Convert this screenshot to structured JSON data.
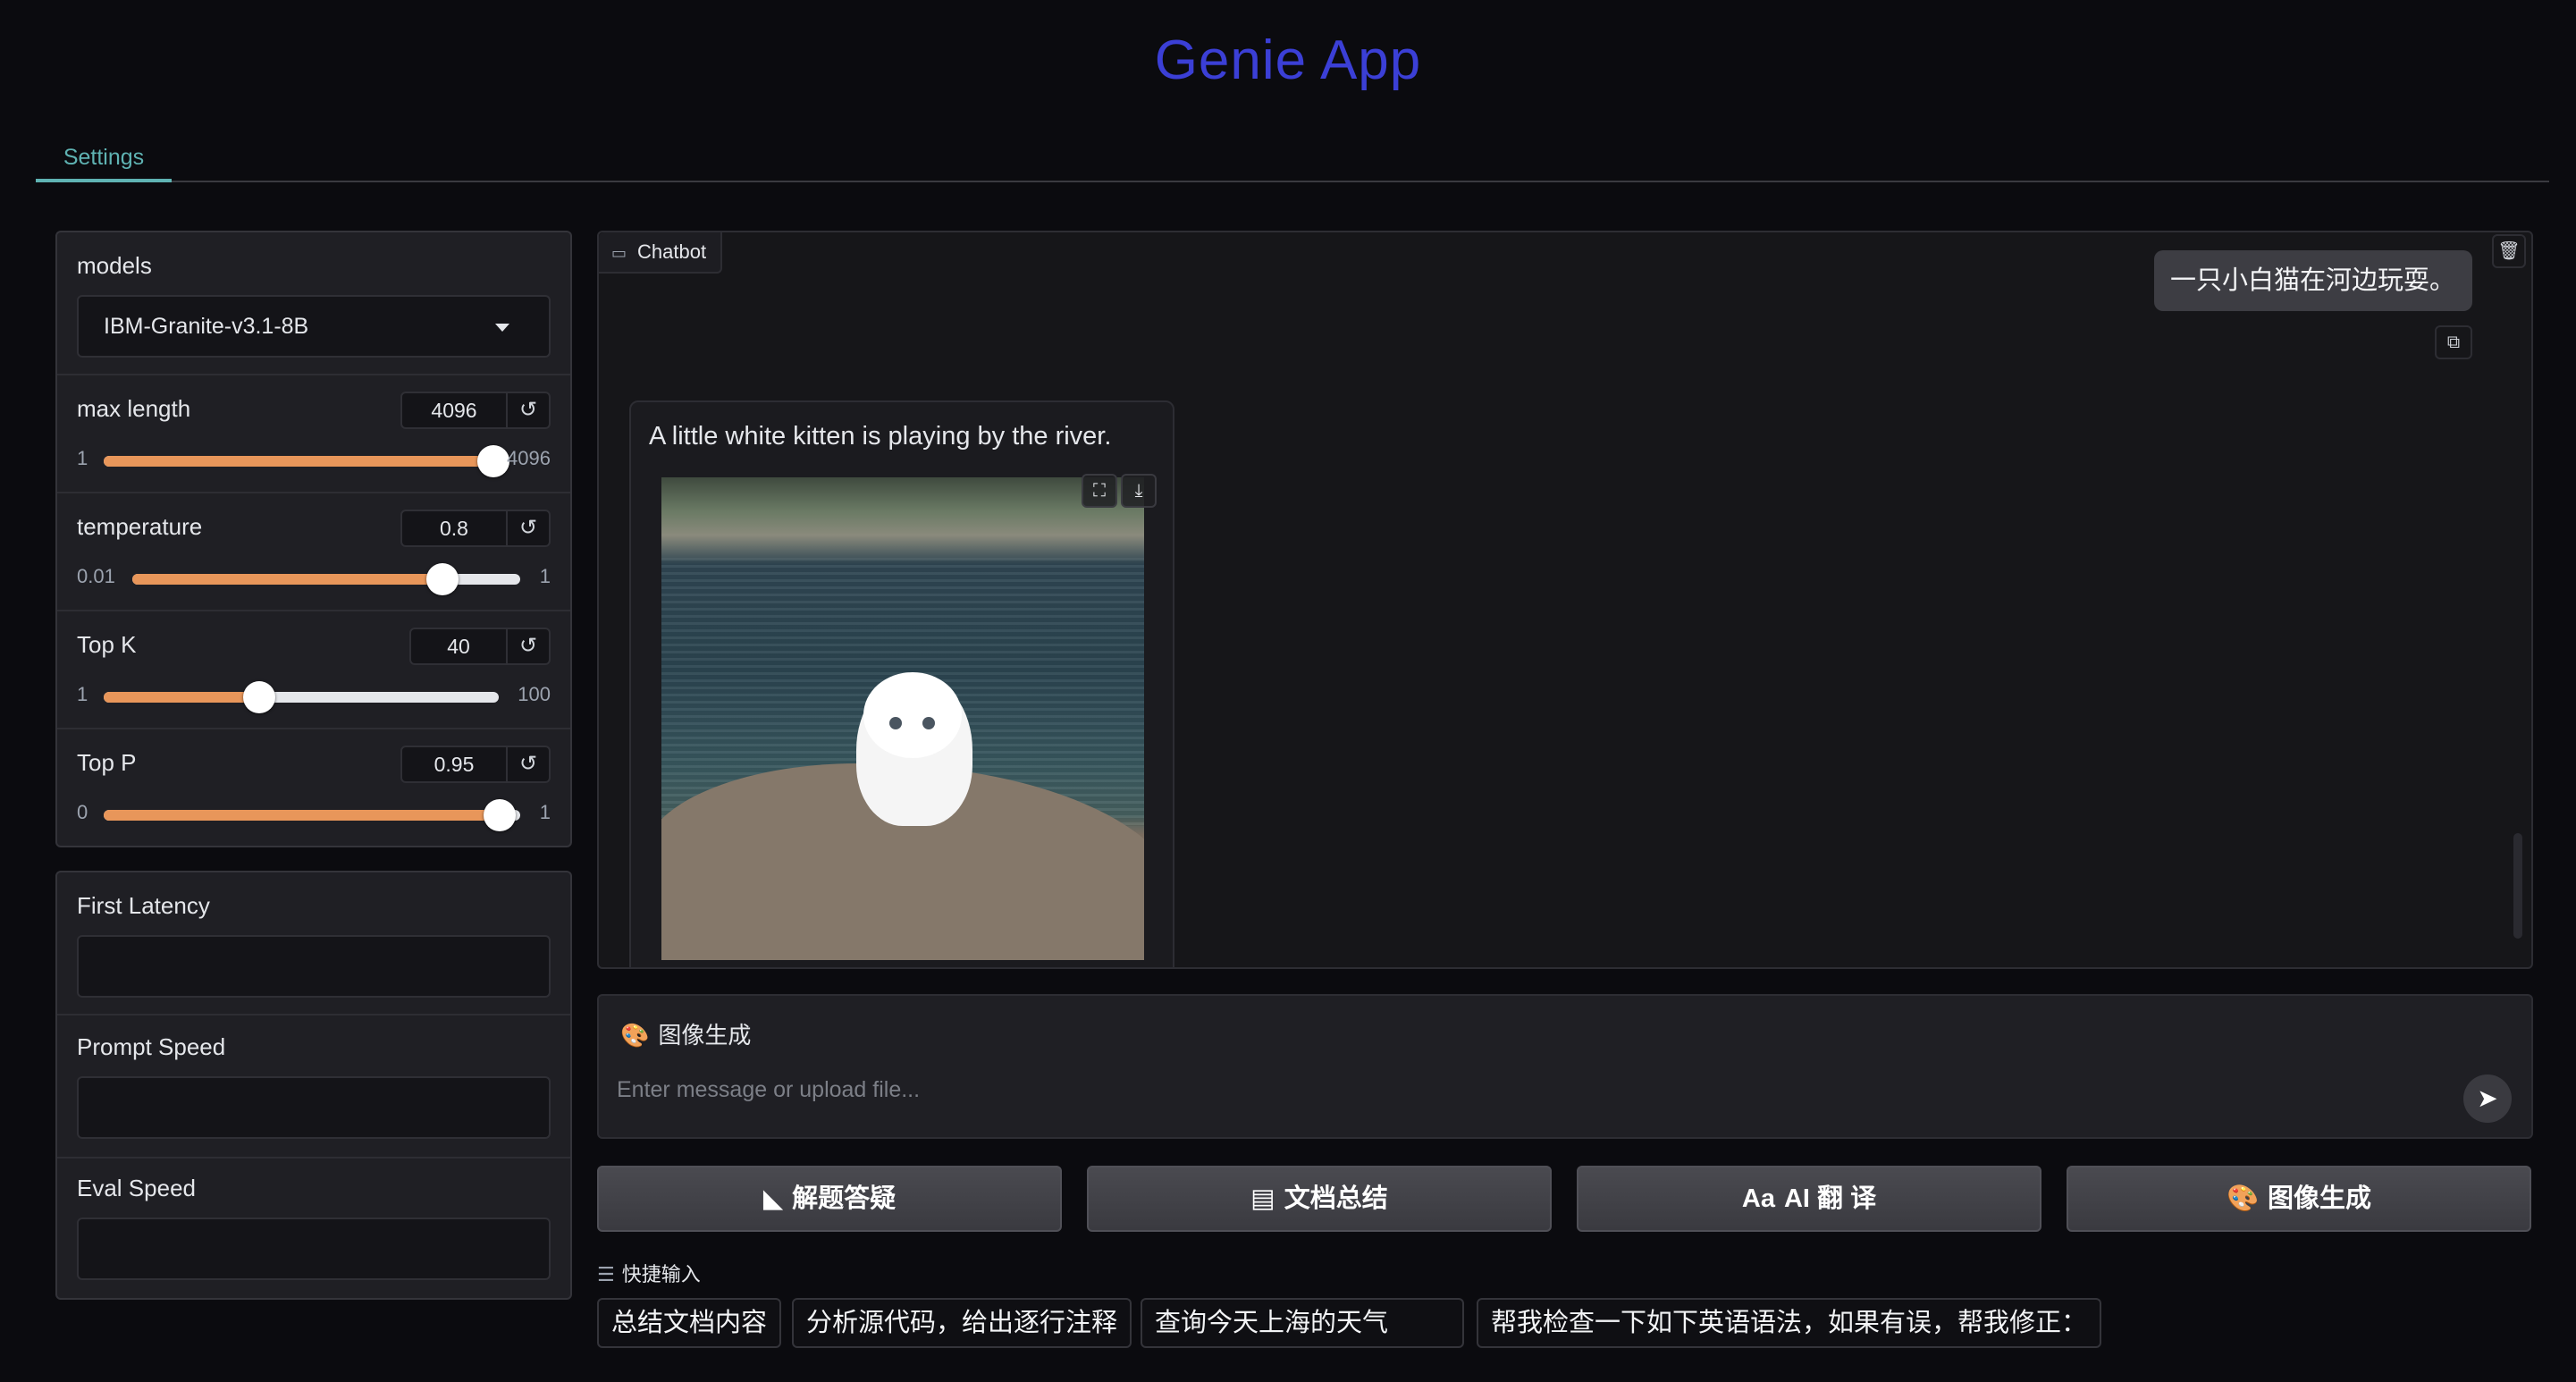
{
  "app": {
    "title": "Genie App"
  },
  "tabs": [
    {
      "label": "Settings"
    }
  ],
  "settings": {
    "models": {
      "label": "models",
      "selected": "IBM-Granite-v3.1-8B"
    },
    "max_length": {
      "label": "max length",
      "value": "4096",
      "min": "1",
      "max": "4096",
      "fill_fraction": 1.0
    },
    "temperature": {
      "label": "temperature",
      "value": "0.8",
      "min": "0.01",
      "max": "1",
      "fill_fraction": 0.8
    },
    "top_k": {
      "label": "Top K",
      "value": "40",
      "min": "1",
      "max": "100",
      "fill_fraction": 0.394
    },
    "top_p": {
      "label": "Top P",
      "value": "0.95",
      "min": "0",
      "max": "1",
      "fill_fraction": 0.95
    },
    "reset_icon": "↺"
  },
  "metrics": {
    "first_latency": {
      "label": "First Latency",
      "value": ""
    },
    "prompt_speed": {
      "label": "Prompt Speed",
      "value": ""
    },
    "eval_speed": {
      "label": "Eval Speed",
      "value": ""
    }
  },
  "chatbot": {
    "label": "Chatbot",
    "messages": [
      {
        "role": "user",
        "text": "一只小白猫在河边玩耍。"
      },
      {
        "role": "assistant",
        "text": "A little white kitten is playing by the river.",
        "image": "white-kitten-by-river"
      }
    ]
  },
  "input": {
    "mode_label": "图像生成",
    "placeholder": "Enter message or upload file..."
  },
  "actions": [
    {
      "label": "解题答疑",
      "icon": "ruler-triangle-icon",
      "glyph": "◣"
    },
    {
      "label": "文档总结",
      "icon": "documents-icon",
      "glyph": "▤"
    },
    {
      "label": "AI 翻 译",
      "icon": "font-size-icon",
      "glyph": "Aa"
    },
    {
      "label": "图像生成",
      "icon": "palette-icon",
      "glyph": "🎨"
    }
  ],
  "quick_input": {
    "label": "快捷输入",
    "items": [
      "总结文档内容",
      "分析源代码，给出逐行注释",
      "查询今天上海的天气",
      "帮我检查一下如下英语语法，如果有误，帮我修正："
    ]
  },
  "colors": {
    "title": "#3b3fd6",
    "accent": "#5fb3b3",
    "slider": "#e8965a",
    "background": "#0b0b0f"
  }
}
